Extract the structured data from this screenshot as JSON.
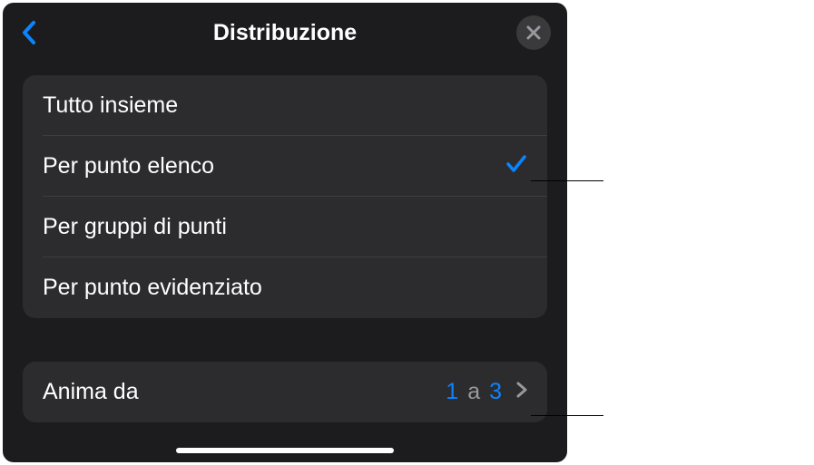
{
  "header": {
    "title": "Distribuzione"
  },
  "options": [
    {
      "label": "Tutto insieme",
      "selected": false
    },
    {
      "label": "Per punto elenco",
      "selected": true
    },
    {
      "label": "Per gruppi di punti",
      "selected": false
    },
    {
      "label": "Per punto evidenziato",
      "selected": false
    }
  ],
  "anima": {
    "label": "Anima da",
    "from": "1",
    "separator": "a",
    "to": "3"
  }
}
